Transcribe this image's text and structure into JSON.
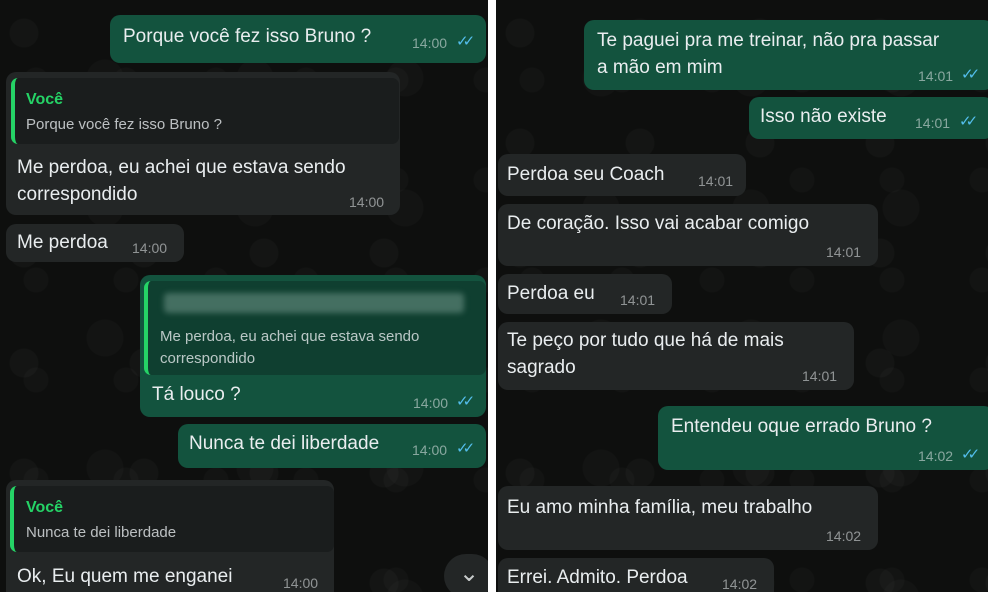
{
  "left": {
    "messages": [
      {
        "text": "Porque você fez isso Bruno ?",
        "time": "14:00"
      },
      {
        "quote_author": "Você",
        "quote_text": "Porque você fez isso Bruno ?",
        "line1": "Me perdoa, eu achei que estava sendo",
        "line2": "correspondido",
        "time": "14:00"
      },
      {
        "text": "Me perdoa",
        "time": "14:00"
      },
      {
        "quote_line1": "Me perdoa, eu achei que estava sendo",
        "quote_line2": "correspondido",
        "text": "Tá louco ?",
        "time": "14:00"
      },
      {
        "text": "Nunca te dei liberdade",
        "time": "14:00"
      },
      {
        "quote_author": "Você",
        "quote_text": "Nunca te dei liberdade",
        "text": "Ok, Eu quem me enganei",
        "time": "14:00"
      }
    ],
    "scroll_icon": "chevron-down-icon"
  },
  "right": {
    "messages": [
      {
        "line1": "Te paguei pra me treinar, não pra passar",
        "line2": "a mão em mim",
        "time": "14:01"
      },
      {
        "text": "Isso não existe",
        "time": "14:01"
      },
      {
        "text": "Perdoa seu Coach",
        "time": "14:01"
      },
      {
        "text": "De coração. Isso vai acabar comigo",
        "time": "14:01"
      },
      {
        "text": "Perdoa eu",
        "time": "14:01"
      },
      {
        "line1": "Te peço por tudo que há de mais",
        "line2": "sagrado",
        "time": "14:01"
      },
      {
        "text": "Entendeu oque errado Bruno ?",
        "time": "14:02"
      },
      {
        "text": "Eu amo minha família, meu trabalho",
        "time": "14:02"
      },
      {
        "text": "Errei. Admito. Perdoa",
        "time": "14:02"
      }
    ]
  },
  "colors": {
    "background": "#0e0f0e",
    "incoming_bubble": "#232626",
    "outgoing_bubble": "#13533e",
    "quote_accent": "#25d366",
    "read_ticks": "#53bdeb"
  }
}
